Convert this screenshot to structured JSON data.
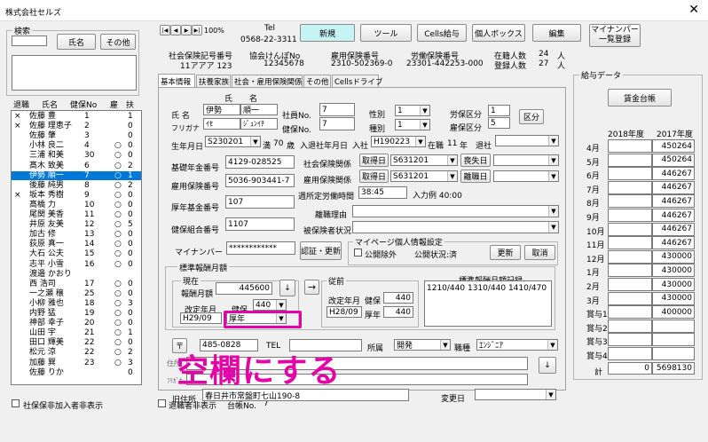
{
  "window": {
    "title": "株式会社セルズ"
  },
  "search": {
    "group_label": "検索",
    "name_button": "氏名",
    "other_button": "その他"
  },
  "list": {
    "headers": [
      "退職",
      "氏名",
      "健保No",
      "雇",
      "扶"
    ],
    "rows": [
      {
        "mark": "×",
        "name": "佐藤 豊",
        "no": "1",
        "emp": "",
        "dep": "1"
      },
      {
        "mark": "×",
        "name": "佐藤 理恵子",
        "no": "2",
        "emp": "",
        "dep": "0"
      },
      {
        "mark": "",
        "name": "佐藤 肇",
        "no": "3",
        "emp": "",
        "dep": "0"
      },
      {
        "mark": "",
        "name": "小林 良二",
        "no": "4",
        "emp": "○",
        "dep": "0"
      },
      {
        "mark": "",
        "name": "三浦 和美",
        "no": "30",
        "emp": "○",
        "dep": "0"
      },
      {
        "mark": "",
        "name": "髙木 致美",
        "no": "6",
        "emp": "○",
        "dep": "2"
      },
      {
        "mark": "",
        "name": "伊勢 順一",
        "no": "7",
        "emp": "○",
        "dep": "1"
      },
      {
        "mark": "",
        "name": "後藤 純男",
        "no": "8",
        "emp": "○",
        "dep": "2"
      },
      {
        "mark": "×",
        "name": "坂本 秀樹",
        "no": "9",
        "emp": "○",
        "dep": "0"
      },
      {
        "mark": "",
        "name": "髙橋 力",
        "no": "10",
        "emp": "○",
        "dep": "0"
      },
      {
        "mark": "",
        "name": "尾関 美香",
        "no": "11",
        "emp": "○",
        "dep": "0"
      },
      {
        "mark": "",
        "name": "井原 友美",
        "no": "12",
        "emp": "○",
        "dep": "5"
      },
      {
        "mark": "",
        "name": "加古 修",
        "no": "13",
        "emp": "○",
        "dep": "0"
      },
      {
        "mark": "",
        "name": "荻原 真一",
        "no": "14",
        "emp": "○",
        "dep": "0"
      },
      {
        "mark": "",
        "name": "大石 公夫",
        "no": "15",
        "emp": "○",
        "dep": "0"
      },
      {
        "mark": "",
        "name": "志平 小雪",
        "no": "16",
        "emp": "○",
        "dep": "0"
      },
      {
        "mark": "",
        "name": "渡邉 かおり",
        "no": "",
        "emp": "",
        "dep": ""
      },
      {
        "mark": "",
        "name": "西 浩司",
        "no": "17",
        "emp": "○",
        "dep": "0"
      },
      {
        "mark": "",
        "name": "一之瀬 穣",
        "no": "25",
        "emp": "○",
        "dep": "0"
      },
      {
        "mark": "",
        "name": "小柳 雅也",
        "no": "18",
        "emp": "○",
        "dep": "3"
      },
      {
        "mark": "",
        "name": "内野 猛",
        "no": "19",
        "emp": "○",
        "dep": "0"
      },
      {
        "mark": "",
        "name": "神部 幸子",
        "no": "20",
        "emp": "○",
        "dep": "0"
      },
      {
        "mark": "",
        "name": "山田 宇",
        "no": "21",
        "emp": "○",
        "dep": "1"
      },
      {
        "mark": "",
        "name": "田口 輝美",
        "no": "22",
        "emp": "○",
        "dep": "0"
      },
      {
        "mark": "",
        "name": "松元 涼",
        "no": "22",
        "emp": "○",
        "dep": "2"
      },
      {
        "mark": "",
        "name": "加藤 巽",
        "no": "23",
        "emp": "○",
        "dep": "3"
      },
      {
        "mark": "",
        "name": "佐藤 りか",
        "no": "",
        "emp": "",
        "dep": "0"
      }
    ],
    "selected_index": 6
  },
  "bottom": {
    "retired_hidden": "退職者非表示",
    "social_unjoined_hidden": "社保保非加入者非表示",
    "ledger_no_label": "台帳No.",
    "ledger_no": "7"
  },
  "nav": {
    "first": "|◀",
    "prev": "◀",
    "next": "▶",
    "last": "▶|",
    "zoom": "100%"
  },
  "tel": {
    "label": "Tel",
    "value": "0568-22-3311"
  },
  "toolbar": {
    "new": "新規",
    "tool": "ツール",
    "cells_pay": "Cells給与",
    "personal_box": "個人ボックス",
    "edit": "編集",
    "mynumber": "マイナンバー",
    "mynumber2": "一覧登録"
  },
  "office": {
    "labels": [
      "社会保険記号番号",
      "協会けんぽNo",
      "雇用保険番号",
      "労働保険番号"
    ],
    "values": [
      "11アアア 123",
      "12345678",
      "2310-502369-0",
      "23301-442253-000"
    ],
    "enrolled_label": "在籍人数",
    "enrolled": "24",
    "enrolled_unit": "人",
    "registered_label": "登録人数",
    "registered": "27",
    "registered_unit": "人"
  },
  "tabs": [
    "基本情報",
    "扶養家族",
    "社会・雇用保険関係",
    "その他",
    "Cellsドライブ"
  ],
  "basic": {
    "name_label": "氏 名",
    "kana_label": "フリガナ",
    "sei_label": "氏",
    "mei_label": "名",
    "sei": "伊勢",
    "mei": "順一",
    "sei_kana": "ｲｾ",
    "mei_kana": "ｼﾞｭﾝｲﾁ",
    "emp_no_label": "社員No.",
    "emp_no": "7",
    "kenpo_no_label": "健保No.",
    "kenpo_no": "7",
    "gender_label": "性別",
    "gender": "1",
    "class_label": "種別",
    "class": "1",
    "labor_label": "労保区分",
    "labor": "1",
    "emp_ins_label": "雇保区分",
    "emp_ins": "5",
    "kubun_button": "区分",
    "birth_label": "生年月日",
    "birth": "S230201",
    "age_prefix": "満",
    "age": "70",
    "age_unit": "歳",
    "join_label": "入退社年月日",
    "join_in": "入社",
    "join": "H190223",
    "tenure_prefix": "在職",
    "tenure": "11",
    "tenure_unit": "年",
    "leave_label": "退社",
    "pension_label": "基礎年金番号",
    "pension": "4129-028525",
    "social_label": "社会保険関係",
    "acquire_btn": "取得日",
    "social_date": "S631201",
    "loss_btn": "喪失日",
    "empins_label": "雇用保険番号",
    "empins": "5036-903441-7",
    "empins_rel_label": "雇用保険関係",
    "empins_date": "S631201",
    "leave_btn": "離職日",
    "week_label": "週所定労働時間",
    "week": "38:45",
    "input_example": "入力例 40:00",
    "nenkin_label": "厚年基金番号",
    "nenkin": "107",
    "resign_reason_label": "離職理由",
    "kumiai_label": "健保組合番号",
    "kumiai": "1107",
    "insured_status_label": "被保険者状況",
    "mynumber_label": "マイナンバー",
    "mynumber": "************",
    "auth_btn": "認証・更新",
    "mp_group": "マイページ個人情報設定",
    "mp_public_exclude": "公開除外",
    "mp_status": "公開状況:済",
    "update_btn": "更新",
    "cancel_btn": "取消",
    "std_group": "標準報酬月額",
    "current_group": "現在",
    "std_monthly_label": "報酬月額",
    "std_monthly": "445600",
    "revision_label": "改定年月",
    "revision": "H29/09",
    "kenpo_label": "健保",
    "kenpo_val": "440",
    "kounen_label": "厚年",
    "prev_group": "従前",
    "prev_revision_label": "改定年月",
    "prev_revision": "H28/09",
    "prev_kenpo_label": "健保",
    "prev_kenpo": "440",
    "prev_kounen_label": "厚年",
    "prev_kounen": "440",
    "history_label": "標準報酬月額記録",
    "history": "1210/440 1310/440 1410/470",
    "zip_label": "〒",
    "zip": "485-0828",
    "tel_label": "TEL",
    "dept_label": "所属",
    "dept": "開発",
    "job_label": "職種",
    "job": "ｴﾝｼﾞﾆｱ",
    "addr_label": "住所",
    "kana2_label": "ﾌﾘｶﾞﾅ",
    "old_addr_label": "旧住所",
    "old_addr": "春日井市常盤町七山190-8",
    "change_label": "変更日"
  },
  "annotation": {
    "text": "空欄にする",
    "color": "#e600a8"
  },
  "salary": {
    "group": "給与データ",
    "ledger_btn": "賃金台帳",
    "years": [
      "2018年度",
      "2017年度"
    ],
    "months": [
      "4月",
      "5月",
      "6月",
      "7月",
      "8月",
      "9月",
      "10月",
      "11月",
      "12月",
      "1月",
      "2月",
      "3月",
      "賞与1",
      "賞与2",
      "賞与3",
      "賞与4"
    ],
    "y2018": [
      "",
      "",
      "",
      "",
      "",
      "",
      "",
      "",
      "",
      "",
      "",
      "",
      "",
      "",
      "",
      ""
    ],
    "y2017": [
      "450264",
      "450264",
      "446267",
      "446267",
      "446267",
      "446267",
      "446267",
      "446267",
      "430000",
      "430000",
      "430000",
      "430000",
      "400000",
      "",
      "",
      ""
    ],
    "total_label": "計",
    "total_2018": "0",
    "total_2017": "5698130"
  }
}
